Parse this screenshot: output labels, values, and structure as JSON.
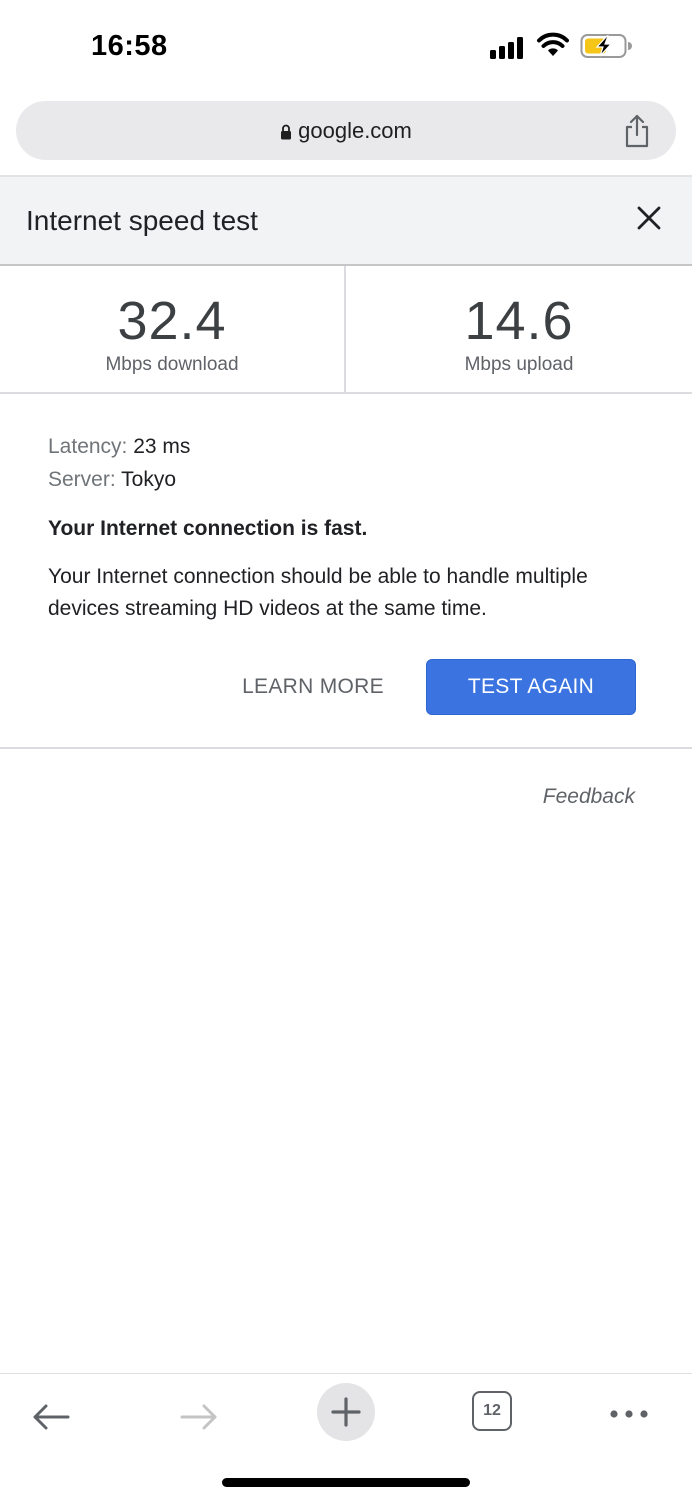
{
  "status_bar": {
    "time": "16:58",
    "icons": [
      "signal-icon",
      "wifi-icon",
      "battery-charging-icon"
    ]
  },
  "browser": {
    "url": "google.com",
    "lock_icon": "lock-icon",
    "share_icon": "share-icon"
  },
  "speed_test": {
    "title": "Internet speed test",
    "close_icon": "close-icon",
    "download": {
      "value": "32.4",
      "unit": "Mbps download"
    },
    "upload": {
      "value": "14.6",
      "unit": "Mbps upload"
    },
    "latency": {
      "label": "Latency:",
      "value": "23 ms"
    },
    "server": {
      "label": "Server:",
      "value": "Tokyo"
    },
    "verdict": "Your Internet connection is fast.",
    "description": "Your Internet connection should be able to handle multiple devices streaming HD videos at the same time.",
    "learn_more_label": "LEARN MORE",
    "test_again_label": "TEST AGAIN",
    "feedback_label": "Feedback",
    "colors": {
      "primary_button": "#3b74e0",
      "header_bg": "#f1f3f4"
    }
  },
  "toolbar": {
    "tab_count": "12",
    "icons": [
      "back-arrow-icon",
      "forward-arrow-icon",
      "plus-icon",
      "tabs-icon",
      "more-icon"
    ]
  }
}
